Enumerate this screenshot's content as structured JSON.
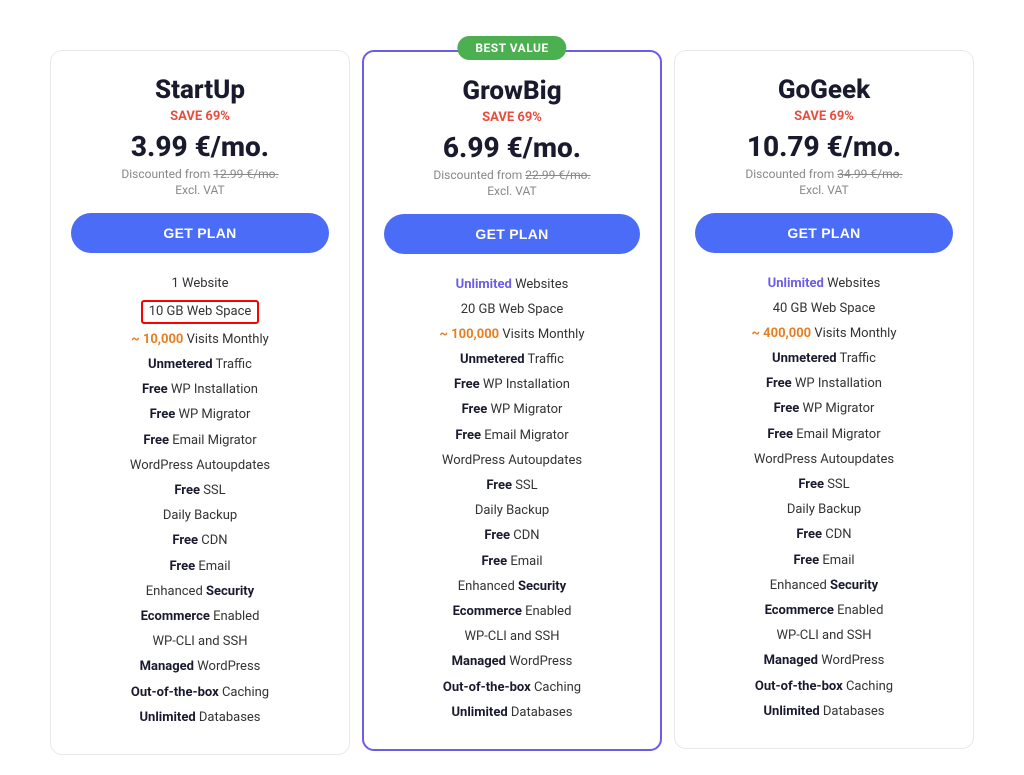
{
  "plans": [
    {
      "id": "startup",
      "name": "StartUp",
      "save": "SAVE 69%",
      "price": "3.99 €/mo.",
      "discounted_from": "12.99 €/mo.",
      "excl_vat": "Excl. VAT",
      "btn_label": "GET PLAN",
      "featured": false,
      "best_value": false,
      "features": [
        {
          "text": "1 Website",
          "bold_part": null,
          "type": "normal"
        },
        {
          "text": "10 GB Web Space",
          "bold_part": null,
          "type": "highlighted"
        },
        {
          "text": "~ 10,000 Visits Monthly",
          "bold_part": "~ 10,000",
          "type": "visits"
        },
        {
          "text": "Unmetered Traffic",
          "bold_part": "Unmetered",
          "type": "bold-first"
        },
        {
          "text": "Free WP Installation",
          "bold_part": "Free",
          "type": "bold-first"
        },
        {
          "text": "Free WP Migrator",
          "bold_part": "Free",
          "type": "bold-first"
        },
        {
          "text": "Free Email Migrator",
          "bold_part": "Free",
          "type": "bold-first"
        },
        {
          "text": "WordPress Autoupdates",
          "bold_part": null,
          "type": "normal"
        },
        {
          "text": "Free SSL",
          "bold_part": "Free",
          "type": "bold-first"
        },
        {
          "text": "Daily Backup",
          "bold_part": null,
          "type": "normal"
        },
        {
          "text": "Free CDN",
          "bold_part": "Free",
          "type": "bold-first"
        },
        {
          "text": "Free Email",
          "bold_part": "Free",
          "type": "bold-first"
        },
        {
          "text": "Enhanced Security",
          "bold_part": "Security",
          "type": "bold-last"
        },
        {
          "text": "Ecommerce Enabled",
          "bold_part": "Ecommerce",
          "type": "bold-first"
        },
        {
          "text": "WP-CLI and SSH",
          "bold_part": null,
          "type": "normal"
        },
        {
          "text": "Managed WordPress",
          "bold_part": "Managed",
          "type": "bold-first"
        },
        {
          "text": "Out-of-the-box Caching",
          "bold_part": "Out-of-the-box",
          "type": "bold-first"
        },
        {
          "text": "Unlimited Databases",
          "bold_part": "Unlimited",
          "type": "bold-first"
        }
      ]
    },
    {
      "id": "growbig",
      "name": "GrowBig",
      "save": "SAVE 69%",
      "price": "6.99 €/mo.",
      "discounted_from": "22.99 €/mo.",
      "excl_vat": "Excl. VAT",
      "btn_label": "GET PLAN",
      "featured": true,
      "best_value": true,
      "best_value_label": "BEST VALUE",
      "features": [
        {
          "text": "Unlimited Websites",
          "bold_part": "Unlimited",
          "type": "bold-first-purple"
        },
        {
          "text": "20 GB Web Space",
          "bold_part": null,
          "type": "normal"
        },
        {
          "text": "~ 100,000 Visits Monthly",
          "bold_part": "~ 100,000",
          "type": "visits"
        },
        {
          "text": "Unmetered Traffic",
          "bold_part": "Unmetered",
          "type": "bold-first"
        },
        {
          "text": "Free WP Installation",
          "bold_part": "Free",
          "type": "bold-first"
        },
        {
          "text": "Free WP Migrator",
          "bold_part": "Free",
          "type": "bold-first"
        },
        {
          "text": "Free Email Migrator",
          "bold_part": "Free",
          "type": "bold-first"
        },
        {
          "text": "WordPress Autoupdates",
          "bold_part": null,
          "type": "normal"
        },
        {
          "text": "Free SSL",
          "bold_part": "Free",
          "type": "bold-first"
        },
        {
          "text": "Daily Backup",
          "bold_part": null,
          "type": "normal"
        },
        {
          "text": "Free CDN",
          "bold_part": "Free",
          "type": "bold-first"
        },
        {
          "text": "Free Email",
          "bold_part": "Free",
          "type": "bold-first"
        },
        {
          "text": "Enhanced Security",
          "bold_part": "Security",
          "type": "bold-last"
        },
        {
          "text": "Ecommerce Enabled",
          "bold_part": "Ecommerce",
          "type": "bold-first"
        },
        {
          "text": "WP-CLI and SSH",
          "bold_part": null,
          "type": "normal"
        },
        {
          "text": "Managed WordPress",
          "bold_part": "Managed",
          "type": "bold-first"
        },
        {
          "text": "Out-of-the-box Caching",
          "bold_part": "Out-of-the-box",
          "type": "bold-first"
        },
        {
          "text": "Unlimited Databases",
          "bold_part": "Unlimited",
          "type": "bold-first"
        }
      ]
    },
    {
      "id": "gogeek",
      "name": "GoGeek",
      "save": "SAVE 69%",
      "price": "10.79 €/mo.",
      "discounted_from": "34.99 €/mo.",
      "excl_vat": "Excl. VAT",
      "btn_label": "GET PLAN",
      "featured": false,
      "best_value": false,
      "features": [
        {
          "text": "Unlimited Websites",
          "bold_part": "Unlimited",
          "type": "bold-first-purple"
        },
        {
          "text": "40 GB Web Space",
          "bold_part": null,
          "type": "normal"
        },
        {
          "text": "~ 400,000 Visits Monthly",
          "bold_part": "~ 400,000",
          "type": "visits"
        },
        {
          "text": "Unmetered Traffic",
          "bold_part": "Unmetered",
          "type": "bold-first"
        },
        {
          "text": "Free WP Installation",
          "bold_part": "Free",
          "type": "bold-first"
        },
        {
          "text": "Free WP Migrator",
          "bold_part": "Free",
          "type": "bold-first"
        },
        {
          "text": "Free Email Migrator",
          "bold_part": "Free",
          "type": "bold-first"
        },
        {
          "text": "WordPress Autoupdates",
          "bold_part": null,
          "type": "normal"
        },
        {
          "text": "Free SSL",
          "bold_part": "Free",
          "type": "bold-first"
        },
        {
          "text": "Daily Backup",
          "bold_part": null,
          "type": "normal"
        },
        {
          "text": "Free CDN",
          "bold_part": "Free",
          "type": "bold-first"
        },
        {
          "text": "Free Email",
          "bold_part": "Free",
          "type": "bold-first"
        },
        {
          "text": "Enhanced Security",
          "bold_part": "Security",
          "type": "bold-last"
        },
        {
          "text": "Ecommerce Enabled",
          "bold_part": "Ecommerce",
          "type": "bold-first"
        },
        {
          "text": "WP-CLI and SSH",
          "bold_part": null,
          "type": "normal"
        },
        {
          "text": "Managed WordPress",
          "bold_part": "Managed",
          "type": "bold-first"
        },
        {
          "text": "Out-of-the-box Caching",
          "bold_part": "Out-of-the-box",
          "type": "bold-first"
        },
        {
          "text": "Unlimited Databases",
          "bold_part": "Unlimited",
          "type": "bold-first"
        }
      ]
    }
  ]
}
